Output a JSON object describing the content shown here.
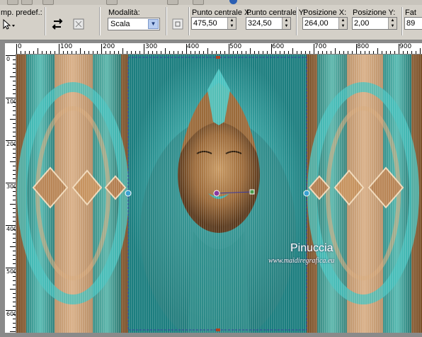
{
  "toolbar": {
    "preset_label": "mp. predef.:",
    "mode_label": "Modalità:",
    "mode_value": "Scala",
    "center_x_label": "Punto centrale X:",
    "center_x_value": "475,50",
    "center_y_label": "Punto centrale Y:",
    "center_y_value": "324,50",
    "pos_x_label": "Posizione X:",
    "pos_x_value": "264,00",
    "pos_y_label": "Posizione Y:",
    "pos_y_value": "2,00",
    "partial_label": "Fat",
    "partial_value": "89"
  },
  "ruler": {
    "h_labels": [
      "0",
      "100",
      "200",
      "300",
      "400",
      "500",
      "600",
      "700",
      "800",
      "900"
    ],
    "v_labels": [
      "0",
      "100",
      "200",
      "300",
      "400",
      "500",
      "600"
    ]
  },
  "canvas": {
    "watermark": "Pinuccia",
    "watermark_url": "www.maidiregrafica.eu"
  },
  "colors": {
    "teal": "#2aa6a6",
    "bronze": "#b07a45",
    "selection": "#3a3aa0"
  },
  "icons": [
    "pick-tool-icon",
    "reset-icon",
    "preset-icon",
    "center-icon",
    "help-icon"
  ]
}
